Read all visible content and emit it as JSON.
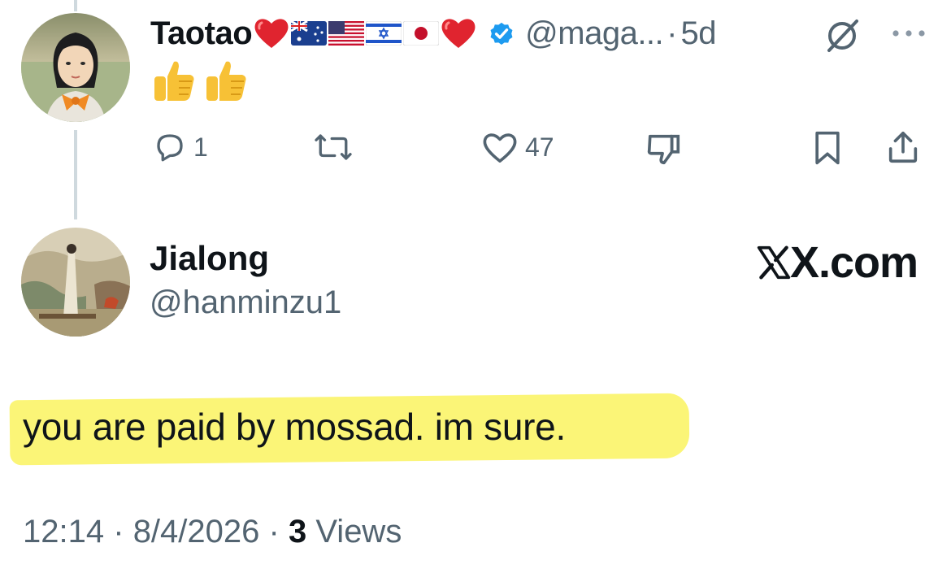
{
  "parent_tweet": {
    "display_name": "Taotao",
    "name_emojis": [
      "red-heart",
      "flag-australia",
      "flag-united-states",
      "flag-israel",
      "flag-japan",
      "red-heart"
    ],
    "verified": true,
    "handle": "@maga...",
    "separator": "·",
    "age": "5d",
    "body_emojis": [
      "thumbs-up",
      "thumbs-up"
    ],
    "actions": {
      "reply_count": "1",
      "retweet_count": "",
      "like_count": "47"
    }
  },
  "reply_tweet": {
    "display_name": "Jialong",
    "handle": "@hanminzu1",
    "brand": "X.com",
    "text": "you are paid by mossad. im sure.",
    "footer": {
      "time": "12:14",
      "sep1": "·",
      "date": "8/4/2026",
      "sep2": "·",
      "views_count": "3",
      "views_label": "Views"
    }
  },
  "colors": {
    "text": "#0f1419",
    "secondary": "#536471",
    "verified": "#1d9bf0",
    "highlight": "#fbf577",
    "thread_line": "#cfd9de"
  }
}
